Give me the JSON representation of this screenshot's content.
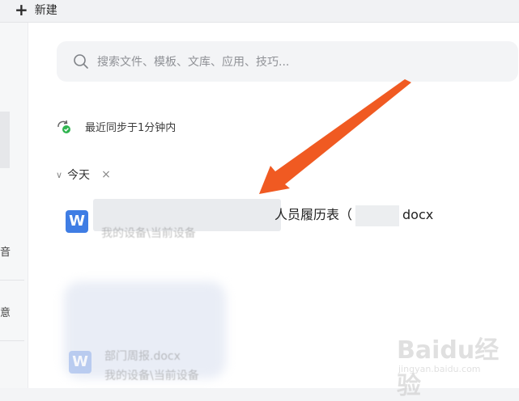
{
  "topbar": {
    "new_label": "新建"
  },
  "left": {
    "glyph1": "音",
    "glyph2": "意"
  },
  "search": {
    "placeholder": "搜索文件、模板、文库、应用、技巧..."
  },
  "sync": {
    "status": "最近同步于1分钟内"
  },
  "group": {
    "label": "今天",
    "close": "×"
  },
  "file": {
    "icon_letter": "W",
    "name_left": "人员履历表（",
    "name_right": "docx",
    "location": "我的设备\\当前设备"
  },
  "faded_file": {
    "icon_letter": "W",
    "name": "部门周报.docx",
    "location": "我的设备\\当前设备"
  },
  "watermark": {
    "brand": "Baidu经验",
    "url": "jingyan.baidu.com"
  },
  "colors": {
    "accent": "#3f7de4",
    "arrow": "#f05a22",
    "sync_green": "#2fb44f"
  }
}
